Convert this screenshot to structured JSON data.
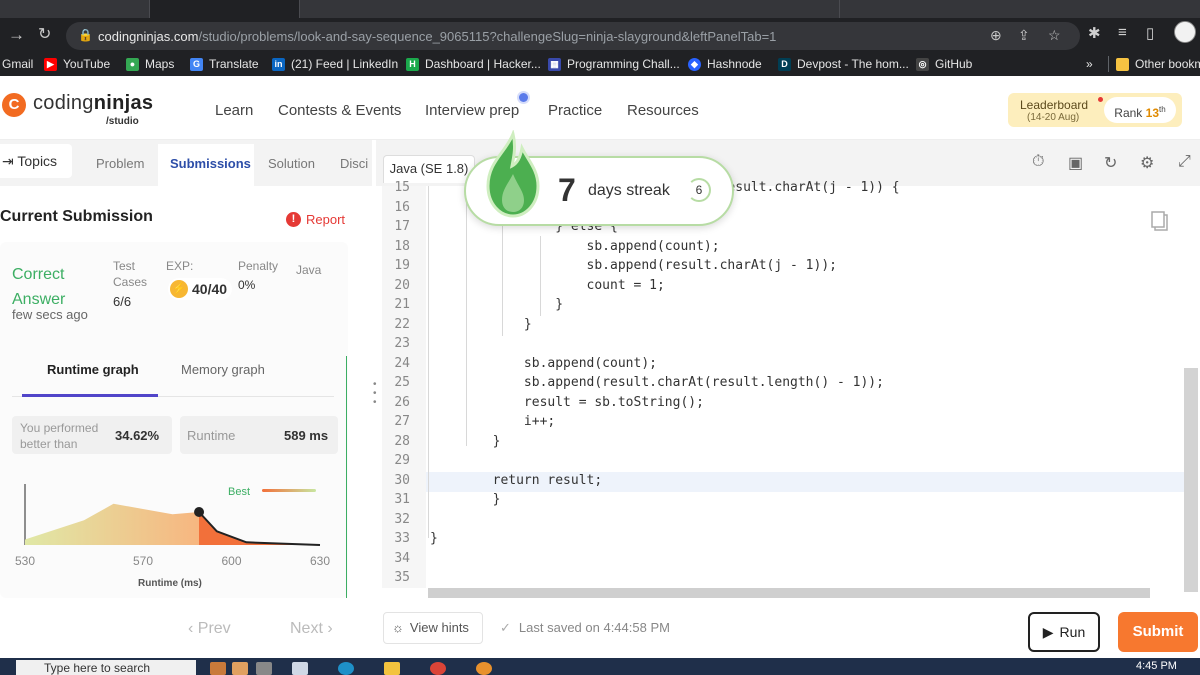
{
  "browser": {
    "url_host": "codingninjas.com",
    "url_path": "/studio/problems/look-and-say-sequence_9065115?challengeSlug=ninja-slayground&leftPanelTab=1",
    "bookmarks": [
      "Gmail",
      "YouTube",
      "Maps",
      "Translate",
      "(21) Feed | LinkedIn",
      "Dashboard | Hacker...",
      "Programming Chall...",
      "Hashnode",
      "Devpost - The hom...",
      "GitHub"
    ],
    "more_label": "»",
    "other_bookmarks": "Other bookm"
  },
  "site": {
    "logo_light": "coding",
    "logo_bold": "ninjas",
    "logo_sub": "/studio",
    "nav": [
      "Learn",
      "Contests & Events",
      "Interview prep",
      "Practice",
      "Resources"
    ],
    "leaderboard": {
      "title": "Leaderboard",
      "dates": "(14-20 Aug)",
      "rank_label": "Rank",
      "rank_value": "13",
      "rank_suffix": "th"
    }
  },
  "left_panel": {
    "topics_label": "Topics",
    "tabs": [
      "Problem",
      "Submissions",
      "Solution",
      "Disci"
    ],
    "current_submission": "Current Submission",
    "report_label": "Report",
    "result_line1": "Correct",
    "result_line2": "Answer",
    "time_ago": "few secs ago",
    "test_cases_label": "Test Cases",
    "test_cases_value": "6/6",
    "exp_label": "EXP:",
    "exp_value": "40/40",
    "penalty_label": "Penalty",
    "penalty_value": "0%",
    "language": "Java",
    "graph_tabs": [
      "Runtime graph",
      "Memory graph"
    ],
    "performed_label": "You performed better than",
    "performed_value": "34.62%",
    "runtime_label": "Runtime",
    "runtime_value": "589 ms",
    "prev_label": "Prev",
    "next_label": "Next"
  },
  "chart_data": {
    "type": "area",
    "xlabel": "Runtime (ms)",
    "ylabel": "",
    "x_ticks": [
      530,
      570,
      600,
      630
    ],
    "xlim": [
      530,
      630
    ],
    "x": [
      530,
      550,
      560,
      580,
      589,
      595,
      605,
      630
    ],
    "y": [
      0.1,
      0.45,
      0.75,
      0.56,
      0.6,
      0.25,
      0.05,
      0.0
    ],
    "marker_x": 589,
    "best_label": "Best",
    "colors": {
      "left_fill": "#f6c28b",
      "right_fill": "#f2703a",
      "line": "#222222",
      "best_grad_start": "#f2703a",
      "best_grad_end": "#c8e6a0"
    }
  },
  "editor": {
    "language_tab": "Java (SE 1.8)",
    "lines": [
      {
        "n": "15",
        "code": "                                  == result.charAt(j - 1)) {"
      },
      {
        "n": "16",
        "code": ""
      },
      {
        "n": "17",
        "code": "                } else {"
      },
      {
        "n": "18",
        "code": "                    sb.append(count);"
      },
      {
        "n": "19",
        "code": "                    sb.append(result.charAt(j - 1));"
      },
      {
        "n": "20",
        "code": "                    count = 1;"
      },
      {
        "n": "21",
        "code": "                }"
      },
      {
        "n": "22",
        "code": "            }"
      },
      {
        "n": "23",
        "code": ""
      },
      {
        "n": "24",
        "code": "            sb.append(count);"
      },
      {
        "n": "25",
        "code": "            sb.append(result.charAt(result.length() - 1));"
      },
      {
        "n": "26",
        "code": "            result = sb.toString();"
      },
      {
        "n": "27",
        "code": "            i++;"
      },
      {
        "n": "28",
        "code": "        }"
      },
      {
        "n": "29",
        "code": ""
      },
      {
        "n": "30",
        "code": "        return result;"
      },
      {
        "n": "31",
        "code": "        }"
      },
      {
        "n": "32",
        "code": ""
      },
      {
        "n": "33",
        "code": "}"
      },
      {
        "n": "34",
        "code": ""
      },
      {
        "n": "35",
        "code": ""
      }
    ],
    "streak_days": "7",
    "streak_text": "days streak",
    "streak_badge": "6",
    "hints_label": "View hints",
    "saved_text": "Last saved on 4:44:58 PM",
    "run_label": "Run",
    "submit_label": "Submit"
  },
  "taskbar": {
    "search_placeholder": "Type here to search",
    "time": "4:45 PM"
  }
}
